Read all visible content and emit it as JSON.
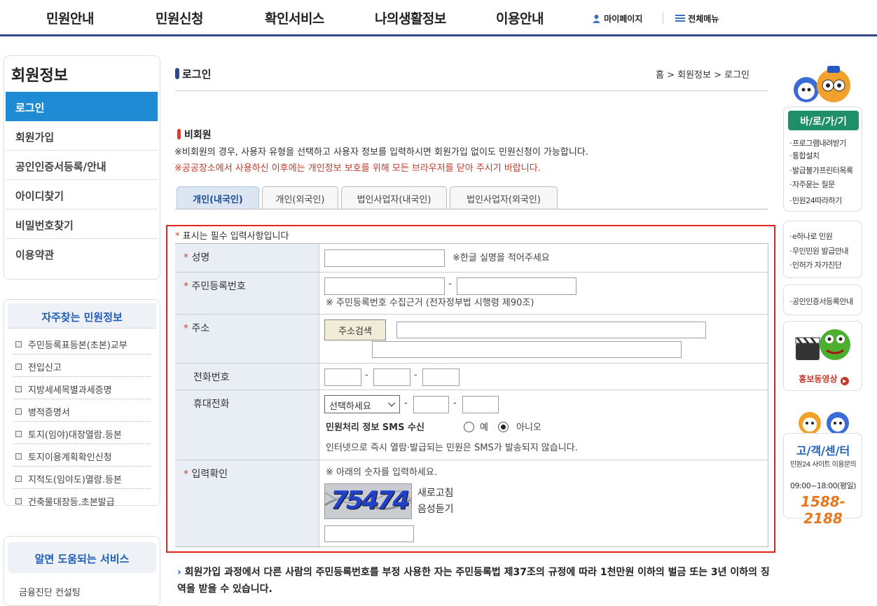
{
  "topnav": {
    "menu": [
      "민원안내",
      "민원신청",
      "확인서비스",
      "나의생활정보",
      "이용안내"
    ],
    "mypage": "마이페이지",
    "allmenu": "전체메뉴"
  },
  "sidebar": {
    "title": "회원정보",
    "items": [
      "로그인",
      "회원가입",
      "공인인증서등록/안내",
      "아이디찾기",
      "비밀번호찾기",
      "이용약관"
    ],
    "freq_title": "자주찾는 민원정보",
    "freq_items": [
      "주민등록표등본(초본)교부",
      "전입신고",
      "지방세세목별과세증명",
      "병적증명서",
      "토지(임야)대장열람.등본",
      "토지이용계획확인신청",
      "지적도(임야도)열람.등본",
      "건축물대장등.초본발급"
    ],
    "help_title": "알면 도움되는 서비스",
    "help_item": "금융진단 컨설팅"
  },
  "page": {
    "title": "로그인",
    "breadcrumb": "홈 > 회원정보 > 로그인",
    "section": "비회원",
    "note1": "비회원의 경우, 사용자 유형을 선택하고 사용자 정보를 입력하시면 회원가입 없이도 민원신청이 가능합니다.",
    "note2": "공공장소에서 사용하신 이후에는 개인정보 보호를 위해 모든 브라우저를 닫아 주시기 바랍니다.",
    "note_mark": "※"
  },
  "tabs": [
    "개인(내국인)",
    "개인(외국인)",
    "법인사업자(내국인)",
    "법인사업자(외국인)"
  ],
  "form": {
    "required_note": "표시는 필수 입력사항입니다",
    "required_mark": "*",
    "name_label": "성명",
    "name_hint": "※한글 실명을 적어주세요",
    "rrn_label": "주민등록번호",
    "rrn_hint": "※ 주민등록번호 수집근거 (전자정부법 시행령 제90조)",
    "address_label": "주소",
    "address_button": "주소검색",
    "phone_label": "전화번호",
    "mobile_label": "휴대전화",
    "mobile_select": "선택하세요",
    "sms_label": "민원처리 정보 SMS 수신",
    "sms_yes": "예",
    "sms_no": "아니오",
    "sms_note": "인터넷으로 즉시 열람·발급되는 민원은 SMS가 발송되지 않습니다.",
    "captcha_label": "입력확인",
    "captcha_hint": "※ 아래의 숫자를 입력하세요.",
    "captcha_text": "75474",
    "refresh": "새로고침",
    "audio": "음성듣기",
    "dash": "-",
    "sms_selected": "아니오"
  },
  "warning": {
    "arrow": "›",
    "text": "회원가입 과정에서 다른 사람의 주민등록번호를 부정 사용한 자는 주민등록법 제37조의 규정에 따라 1천만원 이하의 벌금 또는 3년 이하의 징역을 받을 수 있습니다."
  },
  "quick": {
    "title": "바/로/가/기",
    "links1": [
      "프로그램내려받기",
      "통합설치",
      "발급불가프린터목록",
      "자주묻는 질문",
      "민원24따라하기"
    ],
    "links2": [
      "e하나로 민원",
      "무인민원 발급안내",
      "인허가 자가진단"
    ],
    "links3": [
      "공인인증서등록안내"
    ],
    "video": "홍보동영상",
    "cs_title": "고/객/센/터",
    "cs_sub": "민원24 사이트 이용문의",
    "cs_time": "09:00~18:00(평일)",
    "cs_tel": "1588-2188"
  }
}
